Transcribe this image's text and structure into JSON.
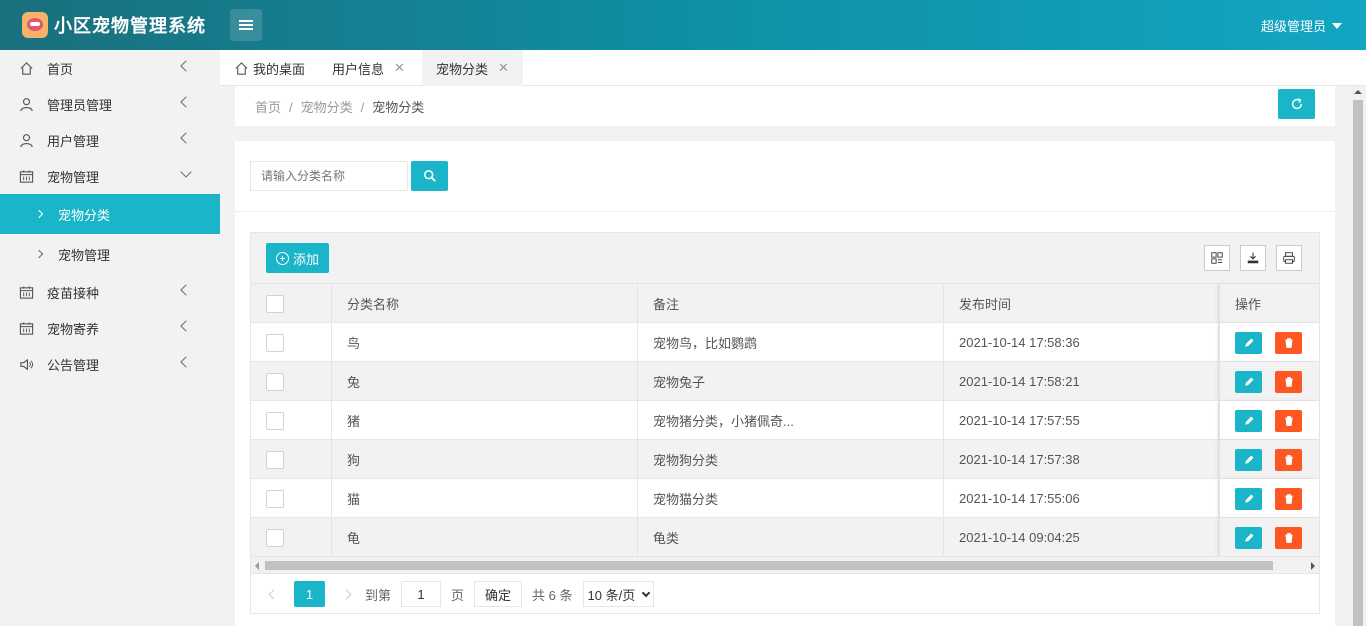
{
  "app": {
    "title": "小区宠物管理系统",
    "user": "超级管理员"
  },
  "sidebar": {
    "items": [
      {
        "label": "首页",
        "icon": "home-icon"
      },
      {
        "label": "管理员管理",
        "icon": "admin-user-icon"
      },
      {
        "label": "用户管理",
        "icon": "user-icon"
      },
      {
        "label": "宠物管理",
        "icon": "calendar-icon"
      },
      {
        "label": "疫苗接种",
        "icon": "calendar-icon"
      },
      {
        "label": "宠物寄养",
        "icon": "calendar-icon"
      },
      {
        "label": "公告管理",
        "icon": "speaker-icon"
      }
    ],
    "sub_items": [
      {
        "label": "宠物分类",
        "active": true
      },
      {
        "label": "宠物管理",
        "active": false
      }
    ]
  },
  "tabs": [
    {
      "label": "我的桌面"
    },
    {
      "label": "用户信息"
    },
    {
      "label": "宠物分类"
    }
  ],
  "breadcrumb": {
    "home": "首页",
    "level1": "宠物分类",
    "level2": "宠物分类"
  },
  "search": {
    "placeholder": "请输入分类名称"
  },
  "toolbar": {
    "add_label": "添加"
  },
  "table": {
    "headers": [
      "分类名称",
      "备注",
      "发布时间",
      "操作"
    ],
    "rows": [
      {
        "name": "鸟",
        "note": "宠物鸟，比如鹦鹉",
        "time": "2021-10-14 17:58:36"
      },
      {
        "name": "兔",
        "note": "宠物兔子",
        "time": "2021-10-14 17:58:21"
      },
      {
        "name": "猪",
        "note": "宠物猪分类，小猪佩奇...",
        "time": "2021-10-14 17:57:55"
      },
      {
        "name": "狗",
        "note": "宠物狗分类",
        "time": "2021-10-14 17:57:38"
      },
      {
        "name": "猫",
        "note": "宠物猫分类",
        "time": "2021-10-14 17:55:06"
      },
      {
        "name": "龟",
        "note": "龟类",
        "time": "2021-10-14 09:04:25"
      }
    ]
  },
  "pager": {
    "current": "1",
    "goto_label": "到第",
    "page_value": "1",
    "page_unit": "页",
    "confirm": "确定",
    "total": "共 6 条",
    "page_size": "10 条/页"
  },
  "colors": {
    "accent": "#1ab5c8",
    "danger": "#ff5722",
    "header": "#0f8fa3"
  }
}
